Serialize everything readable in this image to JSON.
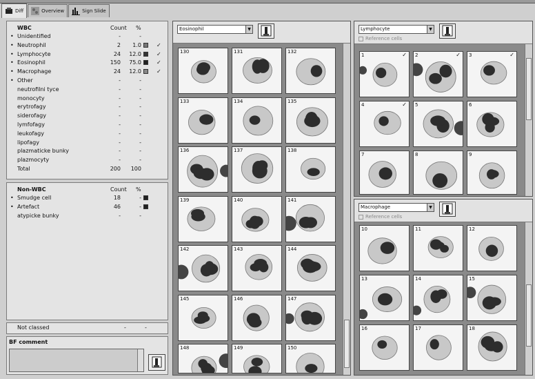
{
  "tabs": [
    {
      "label": "Diff",
      "icon": "diff-icon"
    },
    {
      "label": "Overview",
      "icon": "overview-icon"
    },
    {
      "label": "Sign Slide",
      "icon": "chart-icon"
    }
  ],
  "wbc": {
    "title": "WBC",
    "count_header": "Count",
    "pct_header": "%",
    "rows": [
      {
        "bullet": "•",
        "name": "Unidentified",
        "count": "-",
        "pct": "-",
        "swatch": "",
        "check": ""
      },
      {
        "bullet": "•",
        "name": "Neutrophil",
        "count": "2",
        "pct": "1.0",
        "swatch": "#777777",
        "check": "✓"
      },
      {
        "bullet": "•",
        "name": "Lymphocyte",
        "count": "24",
        "pct": "12.0",
        "swatch": "#333333",
        "check": "✓"
      },
      {
        "bullet": "•",
        "name": "Eosinophil",
        "count": "150",
        "pct": "75.0",
        "swatch": "#222222",
        "check": "✓"
      },
      {
        "bullet": "•",
        "name": "Macrophage",
        "count": "24",
        "pct": "12.0",
        "swatch": "#888888",
        "check": "✓"
      },
      {
        "bullet": "•",
        "name": "Other",
        "count": "-",
        "pct": "-",
        "swatch": "",
        "check": ""
      },
      {
        "bullet": "",
        "name": "neutrofilni tyce",
        "count": "-",
        "pct": "-",
        "swatch": "",
        "check": ""
      },
      {
        "bullet": "",
        "name": "monocyty",
        "count": "-",
        "pct": "-",
        "swatch": "",
        "check": ""
      },
      {
        "bullet": "",
        "name": "erytrofagy",
        "count": "-",
        "pct": "-",
        "swatch": "",
        "check": ""
      },
      {
        "bullet": "",
        "name": "siderofagy",
        "count": "-",
        "pct": "-",
        "swatch": "",
        "check": ""
      },
      {
        "bullet": "",
        "name": "lymfofagy",
        "count": "-",
        "pct": "-",
        "swatch": "",
        "check": ""
      },
      {
        "bullet": "",
        "name": "leukofagy",
        "count": "-",
        "pct": "-",
        "swatch": "",
        "check": ""
      },
      {
        "bullet": "",
        "name": "lipofagy",
        "count": "-",
        "pct": "-",
        "swatch": "",
        "check": ""
      },
      {
        "bullet": "",
        "name": "plazmaticke bunky",
        "count": "-",
        "pct": "-",
        "swatch": "",
        "check": ""
      },
      {
        "bullet": "",
        "name": "plazmocyty",
        "count": "-",
        "pct": "-",
        "swatch": "",
        "check": ""
      },
      {
        "bullet": "",
        "name": "Total",
        "count": "200",
        "pct": "100",
        "swatch": "",
        "check": ""
      }
    ]
  },
  "nonwbc": {
    "title": "Non-WBC",
    "count_header": "Count",
    "pct_header": "%",
    "rows": [
      {
        "bullet": "•",
        "name": "Smudge cell",
        "count": "18",
        "pct": "-",
        "swatch": "#222222"
      },
      {
        "bullet": "•",
        "name": "Artefact",
        "count": "46",
        "pct": "-",
        "swatch": "#222222"
      },
      {
        "bullet": "",
        "name": "atypicke bunky",
        "count": "-",
        "pct": "-",
        "swatch": ""
      }
    ]
  },
  "not_classed": {
    "label": "Not classed",
    "count": "-",
    "pct": "-"
  },
  "bf_comment": {
    "title": "BF comment"
  },
  "col1": {
    "category": "Eosinophil",
    "cells": [
      "130",
      "131",
      "132",
      "133",
      "134",
      "135",
      "136",
      "137",
      "138",
      "139",
      "140",
      "141",
      "142",
      "143",
      "144",
      "145",
      "146",
      "147",
      "148",
      "149",
      "150"
    ]
  },
  "col2": {
    "category": "Lymphocyte",
    "reference": "Reference cells",
    "cells": [
      "1",
      "2",
      "3",
      "4",
      "5",
      "6",
      "7",
      "8",
      "9"
    ],
    "checked": [
      "1",
      "2",
      "3",
      "4"
    ]
  },
  "col3": {
    "category": "Macrophage",
    "reference": "Reference cells",
    "cells": [
      "10",
      "11",
      "12",
      "13",
      "14",
      "15",
      "16",
      "17",
      "18"
    ]
  },
  "accent": {
    "dark": "#2d2d2d",
    "cytoplasm": "#c8c8c8",
    "background": "#f4f4f4"
  }
}
